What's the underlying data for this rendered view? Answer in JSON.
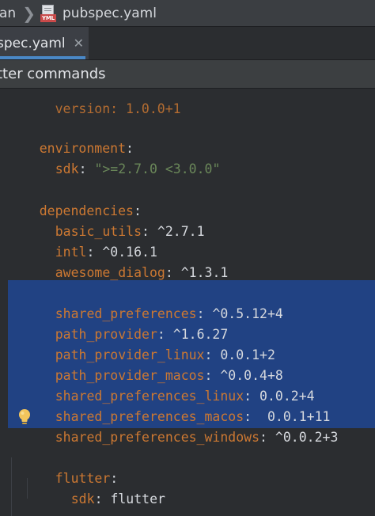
{
  "breadcrumb": {
    "first": "an",
    "separator": "❯",
    "file_icon_label": "YML",
    "file": "pubspec.yaml"
  },
  "tab": {
    "label": "spec.yaml",
    "close": "✕"
  },
  "banner": {
    "text": "tter commands"
  },
  "editor": {
    "partial_line": "version: 1.0.0+1",
    "environment_key": "environment",
    "sdk_key": "sdk",
    "sdk_value": "\">=2.7.0 <3.0.0\"",
    "dependencies_key": "dependencies",
    "deps": [
      {
        "name": "basic_utils",
        "version": "^2.7.1"
      },
      {
        "name": "intl",
        "version": "^0.16.1"
      },
      {
        "name": "awesome_dialog",
        "version": "^1.3.1"
      }
    ],
    "selected_deps": [
      {
        "name": "shared_preferences",
        "version": "^0.5.12+4"
      },
      {
        "name": "path_provider",
        "version": "^1.6.27"
      },
      {
        "name": "path_provider_linux",
        "version": "0.0.1+2"
      },
      {
        "name": "path_provider_macos",
        "version": "^0.0.4+8"
      },
      {
        "name": "shared_preferences_linux",
        "version": "0.0.2+4"
      },
      {
        "name": "shared_preferences_macos",
        "version": " 0.0.1+11"
      },
      {
        "name": "shared_preferences_windows",
        "version": "^0.0.2+3"
      }
    ],
    "flutter_key": "flutter",
    "flutter_sdk_key": "sdk",
    "flutter_sdk_value": "flutter",
    "colon": ":"
  },
  "colors": {
    "key": "#cc7832",
    "string": "#6a8759",
    "selection": "#214283",
    "tab_underline": "#4a88c7"
  },
  "icons": {
    "file": "yaml-file-icon",
    "intention": "lightbulb-icon"
  }
}
